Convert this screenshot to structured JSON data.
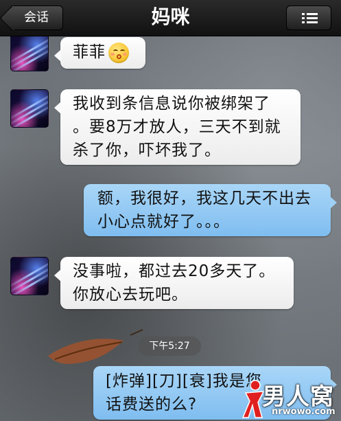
{
  "nav": {
    "back_label": "会话",
    "title": "妈咪",
    "menu_icon": "list-menu-icon"
  },
  "messages": [
    {
      "side": "in",
      "text": "菲菲",
      "emoji": "kissing-face-emoji"
    },
    {
      "side": "in",
      "lines": [
        "我收到条信息说你被绑架了",
        "。要8万才放人，三天不到就",
        "杀了你，吓坏我了。"
      ]
    },
    {
      "side": "out",
      "lines": [
        "额，我很好，我这几天不出去",
        "小心点就好了。。。"
      ]
    },
    {
      "side": "in",
      "lines": [
        "没事啦，都过去20多天了。",
        "你放心去玩吧。"
      ]
    },
    {
      "side": "out",
      "lines": [
        "[炸弹][刀][衰]我是您",
        "话费送的么?"
      ]
    }
  ],
  "timestamp": "下午5:27",
  "watermark": {
    "text": "男人窝",
    "url": "nrwowo.com"
  },
  "colors": {
    "nav_bar": "#111111",
    "incoming_bubble": "#ffffff",
    "outgoing_bubble": "#8cc6f2"
  }
}
